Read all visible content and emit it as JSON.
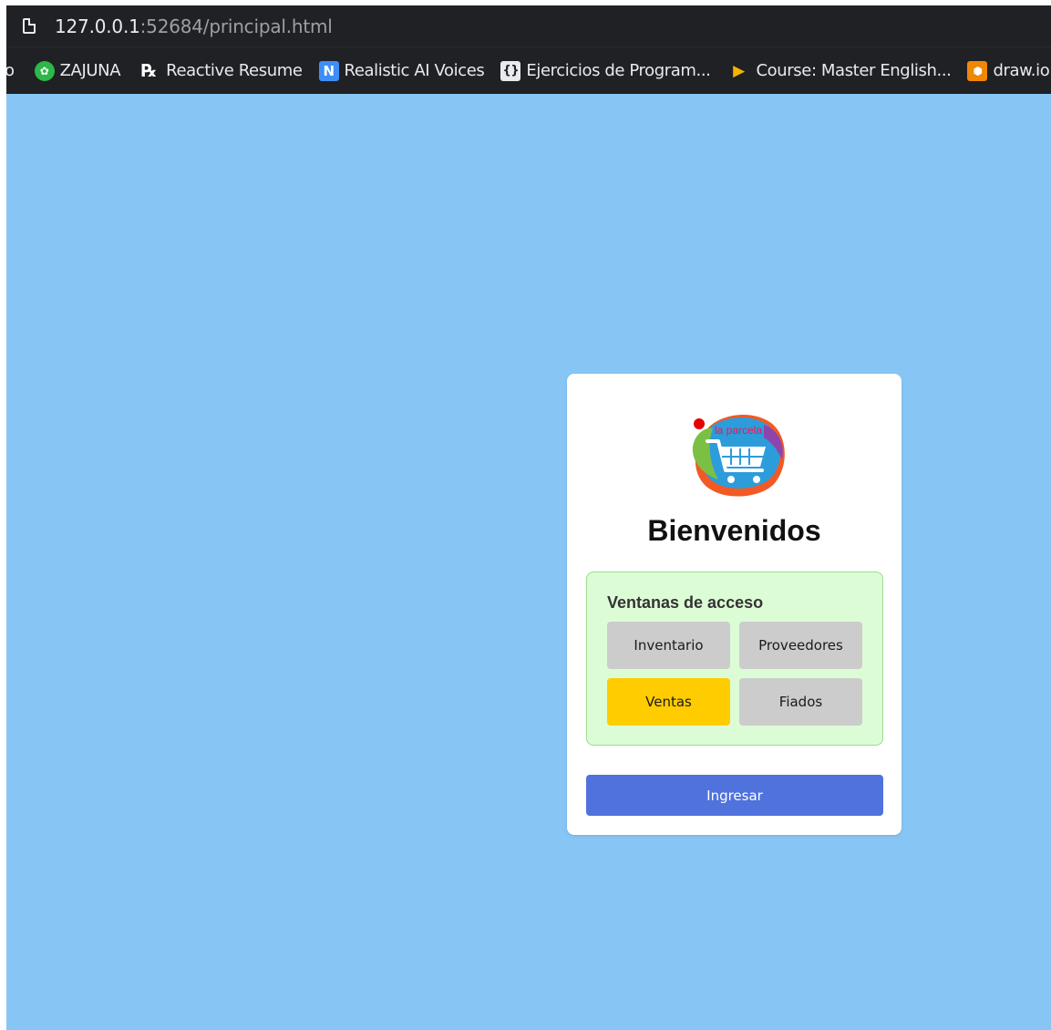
{
  "browser": {
    "url_host": "127.0.0.1",
    "url_path": ":52684/principal.html",
    "bookmarks": [
      {
        "label": "o",
        "icon": "truncated-bookmark"
      },
      {
        "label": "ZAJUNA",
        "icon": "zajuna-icon"
      },
      {
        "label": "Reactive Resume",
        "icon": "rx-icon"
      },
      {
        "label": "Realistic AI Voices",
        "icon": "n-logo-icon"
      },
      {
        "label": "Ejercicios de Program...",
        "icon": "curly-braces-icon"
      },
      {
        "label": "Course: Master English...",
        "icon": "play-arrow-icon"
      },
      {
        "label": "draw.io",
        "icon": "drawio-icon"
      }
    ]
  },
  "page": {
    "background": "#87c6f4",
    "logo_text": "la parcela",
    "title": "Bienvenidos",
    "access_title": "Ventanas de acceso",
    "buttons": {
      "inventario": "Inventario",
      "proveedores": "Proveedores",
      "ventas": "Ventas",
      "fiados": "Fiados"
    },
    "selected_button": "Ventas",
    "submit_label": "Ingresar",
    "colors": {
      "access_box_bg": "#dcfcd6",
      "selected_bg": "#ffcc00",
      "button_bg": "#cccccc",
      "submit_bg": "#5072dd"
    }
  }
}
